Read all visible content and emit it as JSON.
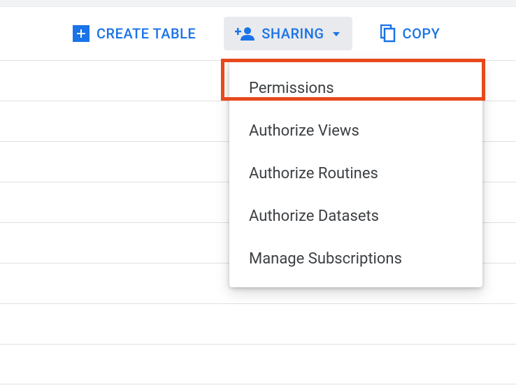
{
  "toolbar": {
    "create_table_label": "CREATE TABLE",
    "sharing_label": "SHARING",
    "copy_label": "COPY"
  },
  "sharing_menu": {
    "items": [
      {
        "label": "Permissions"
      },
      {
        "label": "Authorize Views"
      },
      {
        "label": "Authorize Routines"
      },
      {
        "label": "Authorize Datasets"
      },
      {
        "label": "Manage Subscriptions"
      }
    ]
  },
  "colors": {
    "accent": "#1a73e8",
    "highlight": "#e8481b"
  }
}
